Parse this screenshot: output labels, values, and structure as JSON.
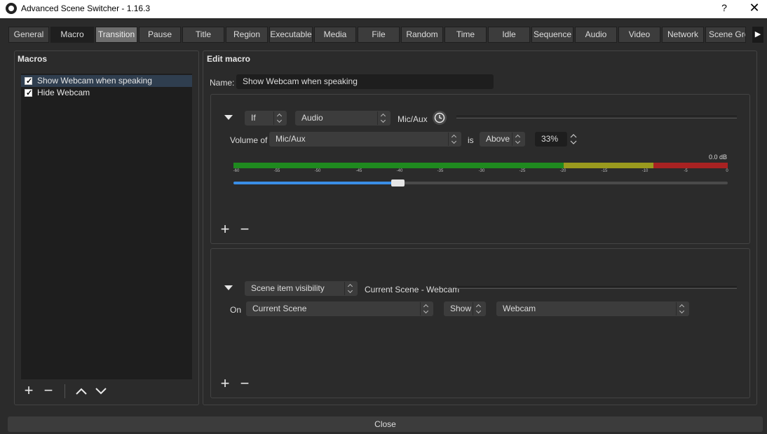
{
  "window": {
    "title": "Advanced Scene Switcher - 1.16.3",
    "help": "?",
    "close": "✕"
  },
  "tabs": [
    "General",
    "Macro",
    "Transition",
    "Pause",
    "Title",
    "Region",
    "Executable",
    "Media",
    "File",
    "Random",
    "Time",
    "Idle",
    "Sequence",
    "Audio",
    "Video",
    "Network",
    "Scene Gro"
  ],
  "active_tab": "Macro",
  "macros": {
    "title": "Macros",
    "items": [
      {
        "label": "Show Webcam when speaking",
        "checked": true,
        "selected": true
      },
      {
        "label": "Hide Webcam",
        "checked": true,
        "selected": false
      }
    ]
  },
  "edit": {
    "title": "Edit macro",
    "name_label": "Name:",
    "name_value": "Show Webcam when speaking",
    "condition": {
      "logic": "If",
      "type": "Audio",
      "header_label": "Mic/Aux",
      "volume_of_label": "Volume of",
      "source": "Mic/Aux",
      "is_label": "is",
      "comparison": "Above",
      "percent": "33%",
      "db_readout": "0.0 dB",
      "slider_value_percent": 33,
      "meter_ticks": [
        "-60",
        "-55",
        "-50",
        "-45",
        "-40",
        "-35",
        "-30",
        "-25",
        "-20",
        "-15",
        "-10",
        "-5",
        "0"
      ]
    },
    "action": {
      "type": "Scene item visibility",
      "header_label": "Current Scene - Webcam",
      "on_label": "On",
      "scene": "Current Scene",
      "visibility": "Show",
      "item": "Webcam"
    }
  },
  "footer": {
    "close_label": "Close"
  },
  "colors": {
    "meter_green": "#1f9a1f",
    "meter_yellow": "#a8a81c",
    "meter_red": "#b32323",
    "slider_blue": "#3a8ee6"
  }
}
